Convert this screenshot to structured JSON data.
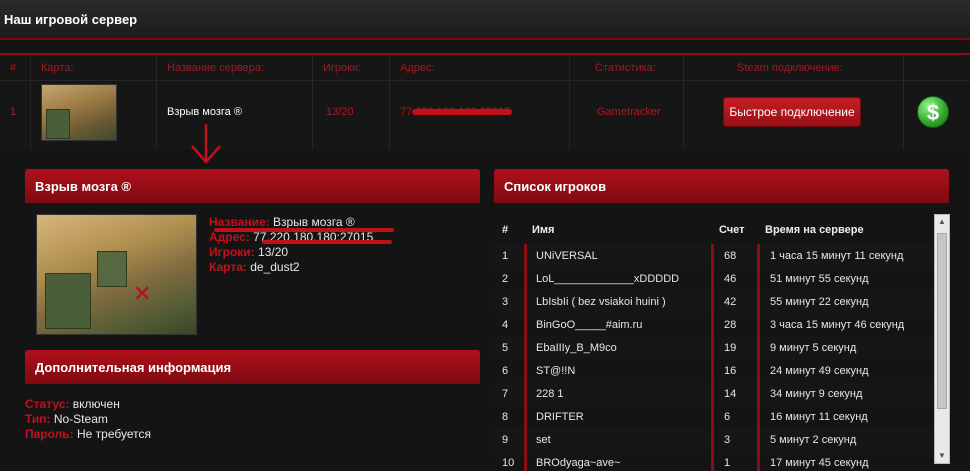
{
  "header": {
    "title": "Наш игровой сервер"
  },
  "server_table": {
    "columns": [
      "#",
      "Карта:",
      "Название сервера:",
      "Игроки:",
      "Адрес:",
      "Статистика:",
      "Steam подключение:"
    ],
    "row": {
      "num": "1",
      "name": "Взрыв мозга ®",
      "players": "13/20",
      "address": "77.220.180.180:27015",
      "stats": "Gametracker",
      "connect_label": "Быстрое подключение",
      "donate_symbol": "$"
    }
  },
  "server_info": {
    "title": "Взрыв мозга ®",
    "name_label": "Название:",
    "name_value": "Взрыв мозга ®",
    "address_label": "Адрес:",
    "address_value": "77.220.180.180:27015",
    "players_label": "Игроки:",
    "players_value": "13/20",
    "map_label": "Карта:",
    "map_value": "de_dust2"
  },
  "extra_info": {
    "title": "Дополнительная информация",
    "status_label": "Статус:",
    "status_value": "включен",
    "type_label": "Тип:",
    "type_value": "No-Steam",
    "password_label": "Пароль:",
    "password_value": "Не требуется"
  },
  "players_panel": {
    "title": "Список игроков",
    "headers": [
      "#",
      "Имя",
      "Счет",
      "Время на сервере"
    ],
    "rows": [
      {
        "n": "1",
        "name": "UNiVERSAL",
        "score": "68",
        "time": "1 часа 15 минут 11 секунд"
      },
      {
        "n": "2",
        "name": "LoL_____________xDDDDD",
        "score": "46",
        "time": "51 минут 55 секунд"
      },
      {
        "n": "3",
        "name": "LbIsbIi ( bez vsiakoi huini )",
        "score": "42",
        "time": "55 минут 22 секунд"
      },
      {
        "n": "4",
        "name": "BinGoO_____#aim.ru",
        "score": "28",
        "time": "3 часа 15 минут 46 секунд"
      },
      {
        "n": "5",
        "name": "EbaIIIy_B_M9co",
        "score": "19",
        "time": "9 минут 5 секунд"
      },
      {
        "n": "6",
        "name": "ST@!!N",
        "score": "16",
        "time": "24 минут 49 секунд"
      },
      {
        "n": "7",
        "name": "228 1",
        "score": "14",
        "time": "34 минут 9 секунд"
      },
      {
        "n": "8",
        "name": "DRIFTER",
        "score": "6",
        "time": "16 минут 11 секунд"
      },
      {
        "n": "9",
        "name": "set",
        "score": "3",
        "time": "5 минут 2 секунд"
      },
      {
        "n": "10",
        "name": "BROdyaga~ave~",
        "score": "1",
        "time": "17 минут 45 секунд"
      }
    ]
  },
  "colors": {
    "accent": "#a01a22",
    "panel": "#9a0d16",
    "button": "#c41d24",
    "donate": "#2ea32a"
  }
}
